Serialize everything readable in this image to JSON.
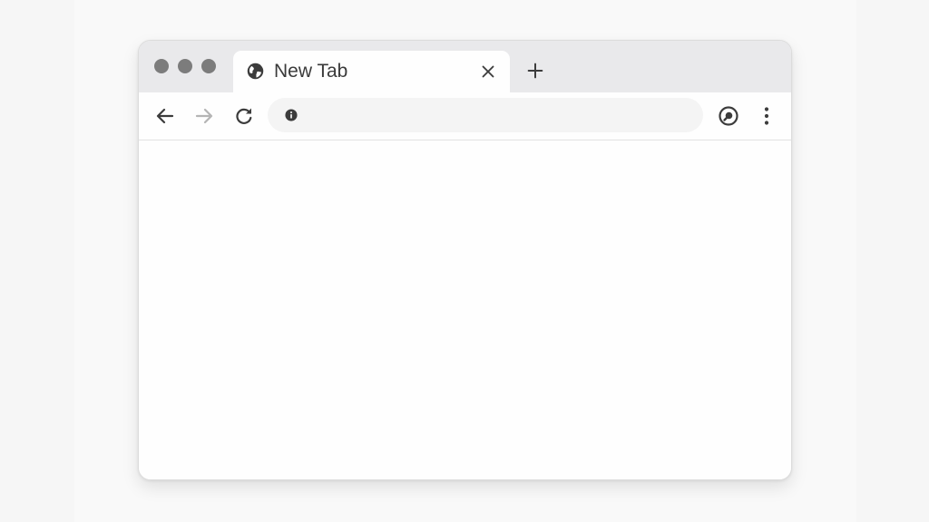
{
  "tab": {
    "title": "New Tab",
    "favicon": "globe-icon"
  },
  "window_controls": [
    "close-dot",
    "minimize-dot",
    "maximize-dot"
  ],
  "toolbar": {
    "back": "arrow-left-icon",
    "forward": "arrow-right-icon",
    "reload": "reload-icon",
    "lens": "lens-icon",
    "menu": "kebab-menu-icon"
  },
  "omnibox": {
    "value": "",
    "placeholder": "",
    "security_icon": "info-icon"
  },
  "colors": {
    "tabstrip_bg": "#e9e9eb",
    "window_bg": "#fefefe",
    "omnibox_bg": "#f4f4f4",
    "icon_dark": "#3c3c3c",
    "icon_disabled": "#b5b5b5",
    "dot": "#7c7c7c"
  }
}
